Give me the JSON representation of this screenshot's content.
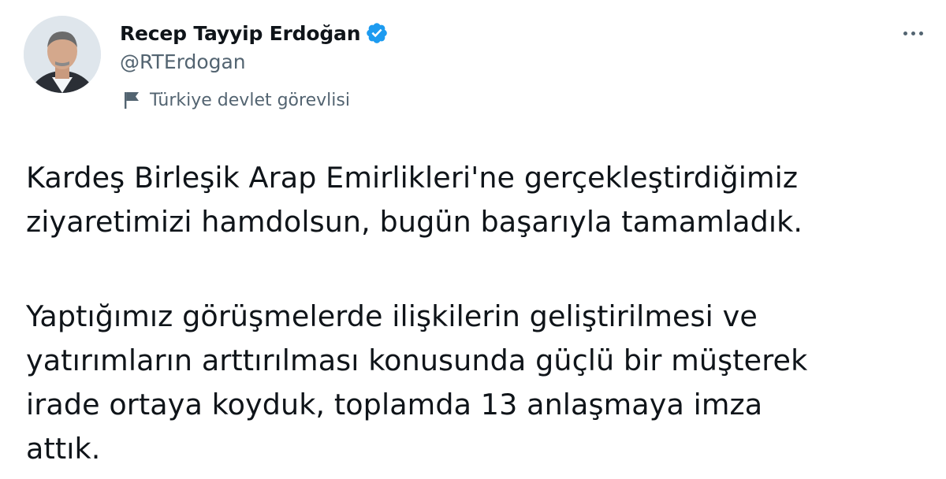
{
  "author": {
    "display_name": "Recep Tayyip Erdoğan",
    "handle": "@RTErdogan",
    "verified": true,
    "label": "Türkiye devlet görevlisi",
    "avatar_icon": "profile-photo",
    "label_icon": "flag-icon"
  },
  "menu": {
    "more_icon": "more-icon"
  },
  "tweet": {
    "paragraph1_line1": "Kardeş Birleşik Arap Emirlikleri'ne gerçekleştirdiğimiz",
    "paragraph1_line2": "ziyaretimizi hamdolsun, bugün başarıyla tamamladık.",
    "paragraph2_line1": "Yaptığımız görüşmelerde ilişkilerin geliştirilmesi ve",
    "paragraph2_line2": "yatırımların arttırılması konusunda güçlü bir müşterek",
    "paragraph2_line3": "irade ortaya koyduk, toplamda 13 anlaşmaya imza",
    "paragraph2_line4": "attık."
  },
  "colors": {
    "text_primary": "#0f1419",
    "text_secondary": "#536471",
    "verified_blue": "#1d9bf0"
  }
}
